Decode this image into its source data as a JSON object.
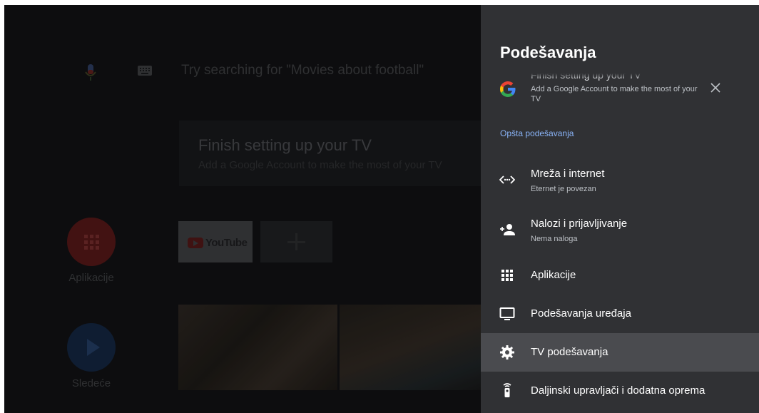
{
  "home": {
    "search_placeholder": "Try searching for \"Movies about football\"",
    "setup_card": {
      "title": "Finish setting up your TV",
      "subtitle": "Add a Google Account to make the most of your TV"
    },
    "apps_label": "Aplikacije",
    "next_label": "Sledeće",
    "youtube_label": "YouTube"
  },
  "settings": {
    "title": "Podešavanja",
    "notification": {
      "title": "Finish setting up your TV",
      "description": "Add a Google Account to make the most of your TV"
    },
    "section_header": "Opšta podešavanja",
    "items": [
      {
        "label": "Mreža i internet",
        "sub": "Eternet je povezan",
        "icon": "network-icon"
      },
      {
        "label": "Nalozi i prijavljivanje",
        "sub": "Nema naloga",
        "icon": "add-account-icon"
      },
      {
        "label": "Aplikacije",
        "icon": "apps-grid-icon"
      },
      {
        "label": "Podešavanja uređaja",
        "icon": "tv-icon"
      },
      {
        "label": "TV podešavanja",
        "icon": "gear-icon",
        "selected": true
      },
      {
        "label": "Daljinski upravljači i dodatna oprema",
        "icon": "remote-icon"
      }
    ]
  },
  "colors": {
    "panel_bg": "#303134",
    "selected_bg": "#4a4b4f",
    "section_accent": "#8ab4f8"
  }
}
